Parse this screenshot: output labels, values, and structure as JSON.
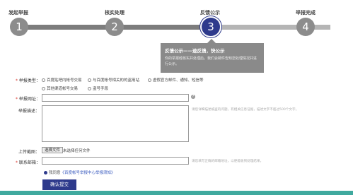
{
  "steps": [
    {
      "title": "发起举报",
      "number": "1"
    },
    {
      "title": "核实处理",
      "number": "2"
    },
    {
      "title": "反馈公示",
      "number": "3"
    },
    {
      "title": "举报完成",
      "number": "4"
    }
  ],
  "active_step": 3,
  "tooltip": {
    "title": "反馈公示——速反馈，快公示",
    "body": "你的举报经核实并处理后，我们会邮件告知您处理情况并进行公示。"
  },
  "form": {
    "type_label": "举报类型：",
    "type_options": [
      "百度贴吧内帐号交易",
      "与百度帐号相关的的盗用站",
      "虚假官方邮件、通知、短信等",
      "其他渠道帐号交易",
      "盗号手段"
    ],
    "url_label": "举报网址：",
    "url_value": "",
    "desc_label": "举报描述：",
    "desc_value": "",
    "desc_hint": "请您详细描述被盗的问题，有相关信息证据，描述文字不超过500个文字。",
    "screenshot_label": "上传截图：",
    "file_button": "选择文件",
    "file_status": "未选择任何文件",
    "email_label": "联系邮箱：",
    "email_value": "",
    "email_hint": "请您填写正确的邮箱地址，以便能收到处理结果。",
    "agree_prefix": "我同意",
    "agree_link": "《百度帐号举报中心举报须知》",
    "submit_label": "确认提交"
  },
  "colors": {
    "accent": "#2e3a8c",
    "step_inactive": "#8c8c8c",
    "required": "#d9342b",
    "footer": "#3fa99e"
  }
}
